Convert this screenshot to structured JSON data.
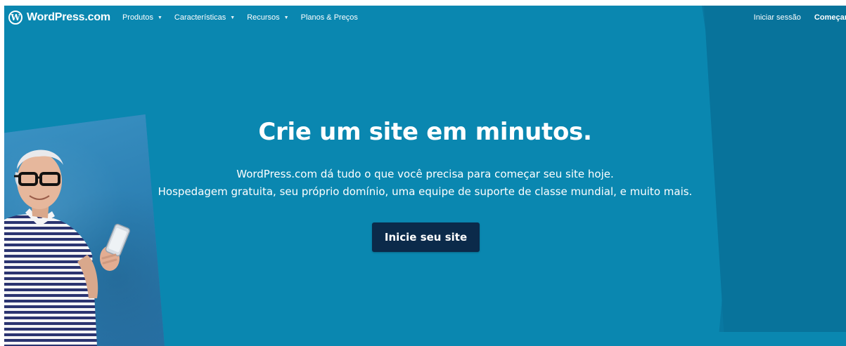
{
  "nav": {
    "brand": "WordPress.com",
    "logo_glyph": "W",
    "items": [
      {
        "label": "Produtos",
        "caret": "▼"
      },
      {
        "label": "Características",
        "caret": "▼"
      },
      {
        "label": "Recursos",
        "caret": "▼"
      },
      {
        "label": "Planos & Preços"
      }
    ],
    "login": "Iniciar sessão",
    "start": "Começar"
  },
  "hero": {
    "title": "Crie um site em minutos.",
    "subtitle_line1": "WordPress.com dá tudo o que você precisa para começar seu site hoje.",
    "subtitle_line2": "Hospedagem gratuita, seu próprio domínio, uma equipe de suporte de classe mundial, e muito mais.",
    "cta": "Inicie seu site"
  },
  "colors": {
    "background": "#0a87b0",
    "button": "#0b2a4a",
    "text": "#ffffff"
  }
}
